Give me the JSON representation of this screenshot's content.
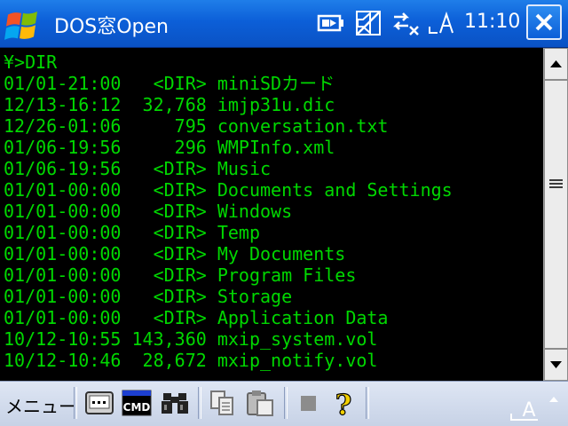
{
  "title_bar": {
    "app_title": "DOS窓Open",
    "clock": "11:10",
    "icons": [
      "windows-start-icon",
      "battery-icon",
      "volume-muted-icon",
      "connectivity-icon",
      "signal-icon",
      "close-icon"
    ]
  },
  "console": {
    "lines": [
      "¥>DIR",
      "01/01-21:00   <DIR> miniSDカード",
      "12/13-16:12  32,768 imjp31u.dic",
      "12/26-01:06     795 conversation.txt",
      "01/06-19:56     296 WMPInfo.xml",
      "01/06-19:56   <DIR> Music",
      "01/01-00:00   <DIR> Documents and Settings",
      "01/01-00:00   <DIR> Windows",
      "01/01-00:00   <DIR> Temp",
      "01/01-00:00   <DIR> My Documents",
      "01/01-00:00   <DIR> Program Files",
      "01/01-00:00   <DIR> Storage",
      "01/01-00:00   <DIR> Application Data",
      "10/12-10:55 143,360 mxip_system.vol",
      "10/12-10:46  28,672 mxip_notify.vol"
    ],
    "text_color": "#00d800",
    "background": "#000000"
  },
  "scrollbar": {
    "icons": [
      "scroll-up-arrow-icon",
      "scroll-thumb-grip-icon",
      "scroll-down-arrow-icon"
    ]
  },
  "command_bar": {
    "menu_label": "メニュー",
    "cmd_label": "CMD",
    "help_label": "?",
    "sip_label": "A",
    "icons": [
      "keyboard-icon",
      "cmd-icon",
      "binoculars-icon",
      "copy-icon",
      "paste-icon",
      "stop-icon",
      "help-icon",
      "input-panel-icon"
    ]
  }
}
